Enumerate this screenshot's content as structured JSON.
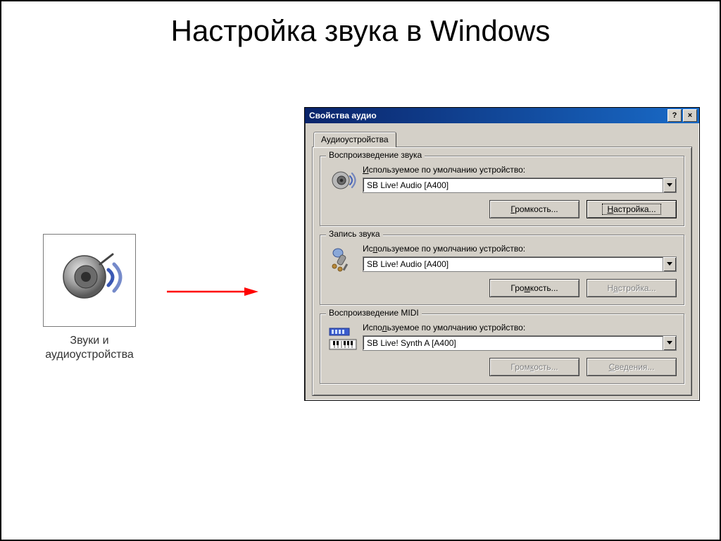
{
  "slide": {
    "title": "Настройка звука в Windows"
  },
  "left_icon": {
    "caption": "Звуки и аудиоустройства"
  },
  "dialog": {
    "title": "Свойства аудио",
    "tab": "Аудиоустройства",
    "help_glyph": "?",
    "close_glyph": "×"
  },
  "playback": {
    "title": "Воспроизведение звука",
    "label_u": "И",
    "label_rest": "спользуемое по умолчанию устройство:",
    "device": "SB Live! Audio [A400]",
    "volume_u": "Г",
    "volume_rest": "ромкость...",
    "settings_u": "Н",
    "settings_rest": "астройка..."
  },
  "recording": {
    "title": "Запись звука",
    "label_pre": "Ис",
    "label_u": "п",
    "label_rest": "ользуемое по умолчанию устройство:",
    "device": "SB Live! Audio [A400]",
    "volume_pre": "Гро",
    "volume_u": "м",
    "volume_rest": "кость...",
    "settings_pre": "Н",
    "settings_u": "а",
    "settings_rest": "стройка..."
  },
  "midi": {
    "title": "Воспроизведение MIDI",
    "label_pre": "Испо",
    "label_u": "л",
    "label_rest": "ьзуемое по умолчанию устройство:",
    "device": "SB Live! Synth A [A400]",
    "volume_pre": "Гром",
    "volume_u": "к",
    "volume_rest": "ость...",
    "about_u": "С",
    "about_rest": "ведения..."
  }
}
